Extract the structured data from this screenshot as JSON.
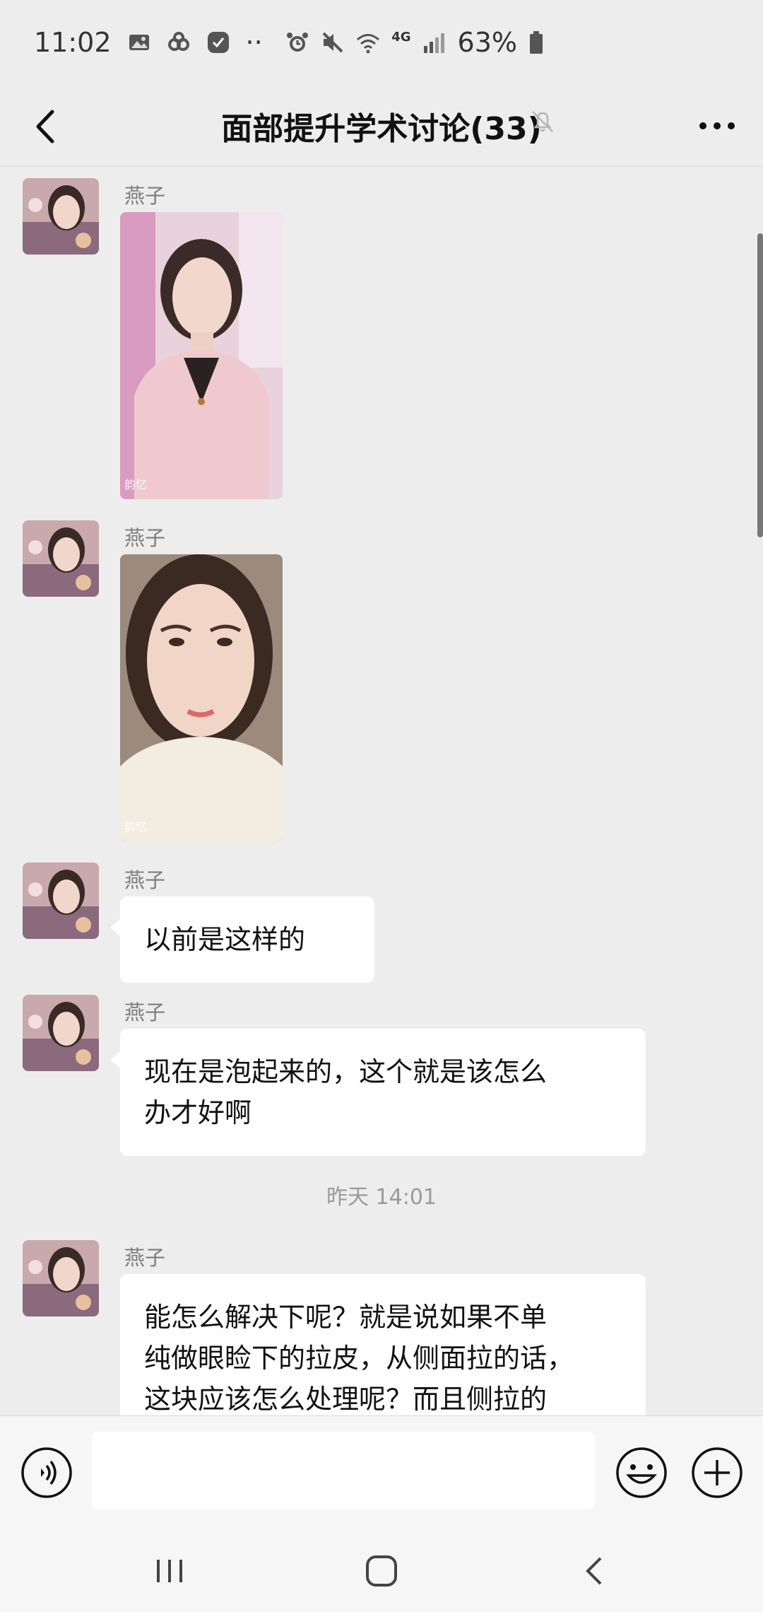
{
  "status_bar": {
    "time": "11:02",
    "dots": "··",
    "network": "4G",
    "battery": "63%"
  },
  "nav": {
    "title": "面部提升学术讨论(33)"
  },
  "messages": [
    {
      "sender": "燕子",
      "type": "image",
      "watermark": "韵忆"
    },
    {
      "sender": "燕子",
      "type": "image",
      "watermark": "韵忆"
    },
    {
      "sender": "燕子",
      "type": "text",
      "lines": [
        "以前是这样的"
      ]
    },
    {
      "sender": "燕子",
      "type": "text",
      "lines": [
        "现在是泡起来的，这个就是该怎么",
        "办才好啊"
      ]
    },
    {
      "sender": "燕子",
      "type": "text",
      "lines": [
        "能怎么解决下呢？就是说如果不单",
        "纯做眼睑下的拉皮，从侧面拉的话，",
        "这块应该怎么处理呢？而且侧拉的"
      ]
    }
  ],
  "time_separator": "昨天 14:01",
  "input": {
    "value": ""
  },
  "colors": {
    "background": "#ededed",
    "bubble": "#ffffff",
    "sender": "#7d7d7d"
  }
}
